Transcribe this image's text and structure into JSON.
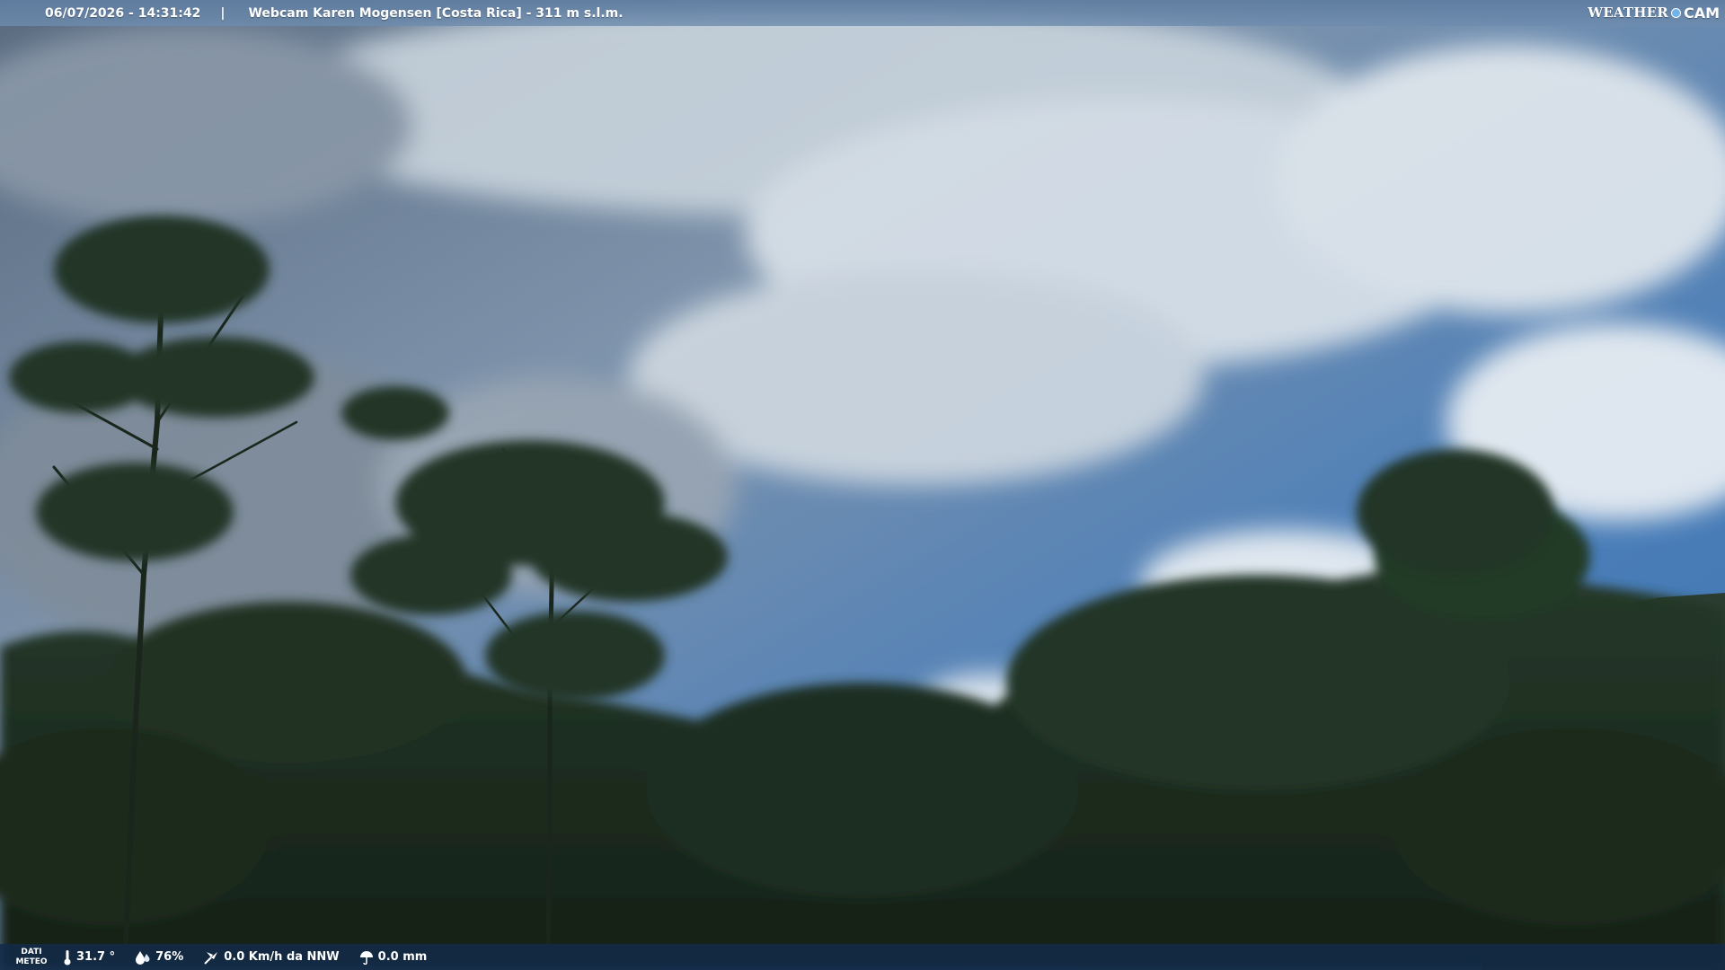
{
  "header": {
    "datetime": "06/07/2026 - 14:31:42",
    "separator": "|",
    "title": "Webcam Karen Mogensen [Costa Rica] - 311 m s.l.m.",
    "logo": {
      "word": "WEATHER",
      "suffix": "CAM"
    }
  },
  "footer": {
    "dati_line1": "DATI",
    "dati_line2": "METEO",
    "temperature": "31.7 °",
    "humidity": "76%",
    "wind": "0.0 Km/h da NNW",
    "rain": "0.0 mm"
  },
  "colors": {
    "sky_top": "#5b6f86",
    "sky_blue": "#4c7fb9",
    "foliage": "#1d2e20",
    "bottom_bar": "#122a48"
  },
  "icons": [
    "thermometer-icon",
    "humidity-drop-icon",
    "wind-icon",
    "rain-umbrella-icon"
  ]
}
